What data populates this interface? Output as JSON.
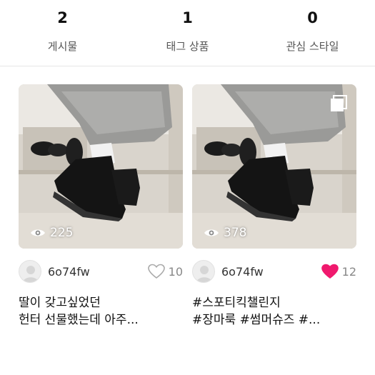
{
  "stats": [
    {
      "count": "2",
      "label": "게시물"
    },
    {
      "count": "1",
      "label": "태그 상품"
    },
    {
      "count": "0",
      "label": "관심 스타일"
    }
  ],
  "posts": [
    {
      "views": "225",
      "username": "6o74fw",
      "likes": "10",
      "liked": false,
      "caption_lines": [
        "딸이 갖고싶었던",
        "헌터 선물했는데 아주..."
      ],
      "multi_image": false
    },
    {
      "views": "378",
      "username": "6o74fw",
      "likes": "12",
      "liked": true,
      "caption_lines": [
        "#스포티킥챌린지",
        "#장마룩 #썸머슈즈 #..."
      ],
      "multi_image": true
    }
  ],
  "colors": {
    "like_active": "#f0196e",
    "like_inactive": "#aaaaaa"
  },
  "icons": {
    "views": "eye-icon",
    "like": "heart-icon",
    "multi": "multi-image-icon",
    "avatar": "default-avatar-icon"
  }
}
